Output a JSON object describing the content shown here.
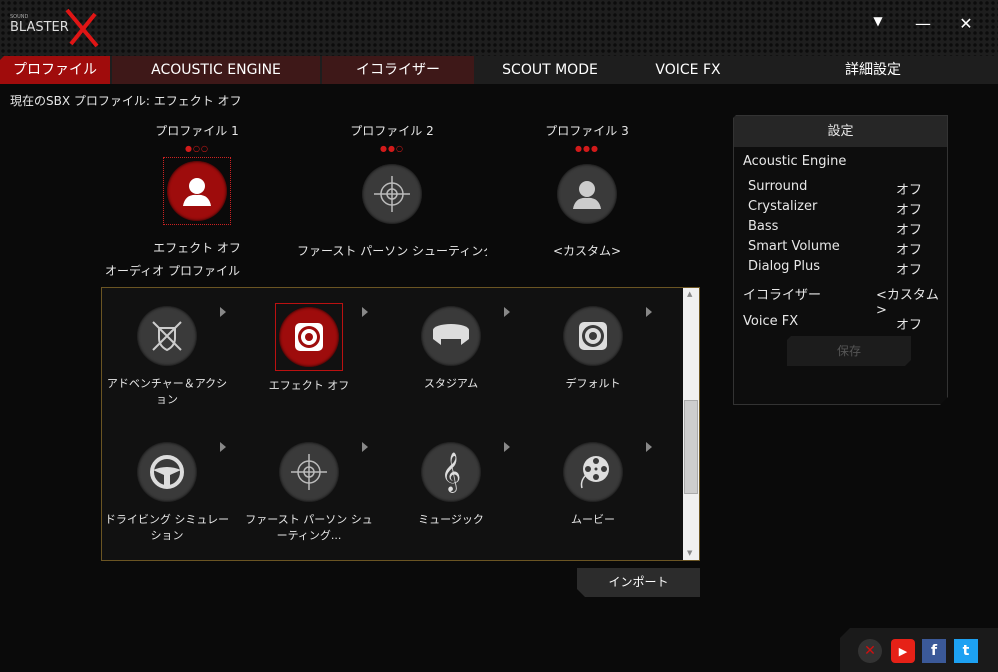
{
  "window": {
    "logo_small": "SOUND",
    "logo": "BLASTER",
    "menu_icon": "▼",
    "minimize_icon": "—",
    "close_icon": "✕"
  },
  "tabs": [
    "プロファイル",
    "ACOUSTIC ENGINE",
    "イコライザー",
    "SCOUT MODE",
    "VOICE FX",
    "詳細設定"
  ],
  "status": "現在のSBX プロファイル: エフェクト オフ",
  "profiles": [
    {
      "label": "プロファイル 1",
      "dots": "●○○",
      "name": "エフェクト オフ"
    },
    {
      "label": "プロファイル 2",
      "dots": "●●○",
      "name": "ファースト パーソン シューティング（FF"
    },
    {
      "label": "プロファイル 3",
      "dots": "●●●",
      "name": "<カスタム>"
    }
  ],
  "audio_profile_label": "オーディオ プロファイル",
  "audio_profiles": [
    {
      "name": "アドベンチャー＆アクション"
    },
    {
      "name": "エフェクト オフ"
    },
    {
      "name": "スタジアム"
    },
    {
      "name": "デフォルト"
    },
    {
      "name": "ドライビング シミュレーション"
    },
    {
      "name": "ファースト パーソン シューティング..."
    },
    {
      "name": "ミュージック"
    },
    {
      "name": "ムービー"
    }
  ],
  "import_label": "インポート",
  "settings": {
    "title": "設定",
    "acoustic_engine": "Acoustic Engine",
    "rows": [
      {
        "label": "Surround",
        "value": "オフ"
      },
      {
        "label": "Crystalizer",
        "value": "オフ"
      },
      {
        "label": "Bass",
        "value": "オフ"
      },
      {
        "label": "Smart Volume",
        "value": "オフ"
      },
      {
        "label": "Dialog Plus",
        "value": "オフ"
      }
    ],
    "eq_label": "イコライザー",
    "eq_value": "<カスタム>",
    "voicefx_label": "Voice FX",
    "voicefx_value": "オフ",
    "save_label": "保存"
  },
  "social": {
    "x": "✕",
    "youtube": "▶",
    "facebook": "f",
    "twitter": "t"
  },
  "colors": {
    "accent": "#a00c0c",
    "youtube": "#e62117",
    "facebook": "#3b5998",
    "twitter": "#1da1f2"
  }
}
